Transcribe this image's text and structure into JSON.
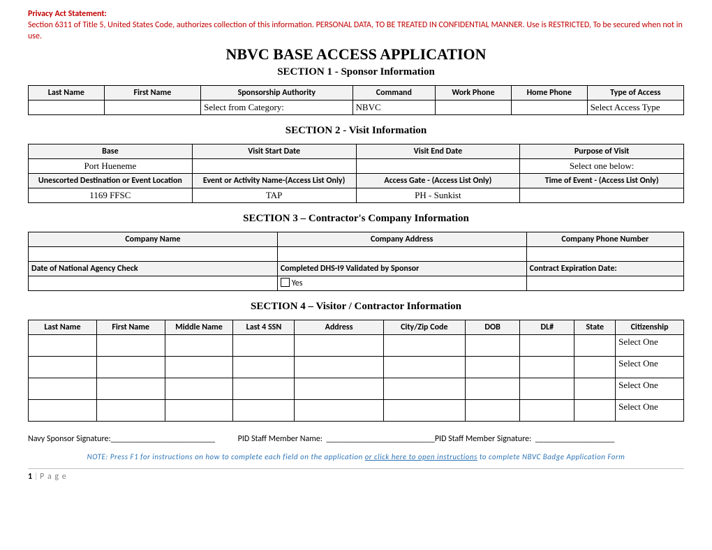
{
  "privacy": {
    "heading": "Privacy Act Statement:",
    "body": "Section 6311 of Title 5, United States Code, authorizes collection of this information. PERSONAL DATA, TO BE TREATED IN CONFIDENTIAL MANNER. Use is RESTRICTED, To be secured when not in use."
  },
  "title": "NBVC BASE ACCESS APPLICATION",
  "section1": {
    "heading": "SECTION 1 - Sponsor Information",
    "headers": [
      "Last Name",
      "First Name",
      "Sponsorship Authority",
      "Command",
      "Work Phone",
      "Home Phone",
      "Type of Access"
    ],
    "row": {
      "last": "",
      "first": "",
      "authority": "Select from Category:",
      "command": "NBVC",
      "workphone": "",
      "homephone": "",
      "access": "Select Access Type"
    }
  },
  "section2": {
    "heading": "SECTION 2 - Visit Information",
    "headers1": [
      "Base",
      "Visit Start Date",
      "Visit End Date",
      "Purpose of Visit"
    ],
    "row1": {
      "base": "Port Hueneme",
      "start": "",
      "end": "",
      "purpose": "Select one below:"
    },
    "headers2": [
      "Unescorted Destination  or Event Location",
      "Event or Activity Name-(Access List Only)",
      "Access Gate - (Access List Only)",
      "Time of Event - (Access List Only)"
    ],
    "row2": {
      "dest": "1169 FFSC",
      "event": "TAP",
      "gate": "PH - Sunkist",
      "time": ""
    }
  },
  "section3": {
    "heading": "SECTION 3 – Contractor's Company Information",
    "headers1": [
      "Company Name",
      "Company Address",
      "Company Phone Number"
    ],
    "row1": {
      "name": "",
      "addr": "",
      "phone": ""
    },
    "headers2": [
      "Date of National Agency Check",
      "Completed DHS-I9 Validated by Sponsor",
      "Contract Expiration Date:"
    ],
    "row2": {
      "nac": "",
      "dhs": "Yes",
      "exp": ""
    }
  },
  "section4": {
    "heading": "SECTION 4 – Visitor / Contractor Information",
    "headers": [
      "Last Name",
      "First Name",
      "Middle Name",
      "Last 4 SSN",
      "Address",
      "City/Zip Code",
      "DOB",
      "DL#",
      "State",
      "Citizenship"
    ],
    "citizenship_default": "Select One"
  },
  "signatures": {
    "sponsor": "Navy Sponsor Signature:",
    "staff_name": "PID Staff Member Name:",
    "staff_sig": "PID Staff Member Signature:"
  },
  "note": {
    "prefix": "NOTE:  Press F1 for instructions on how to complete each field on the application ",
    "link": "or click here to open instructions",
    "suffix": " to complete NBVC Badge Application Form"
  },
  "footer": {
    "page": "1",
    "label": "P a g e"
  }
}
